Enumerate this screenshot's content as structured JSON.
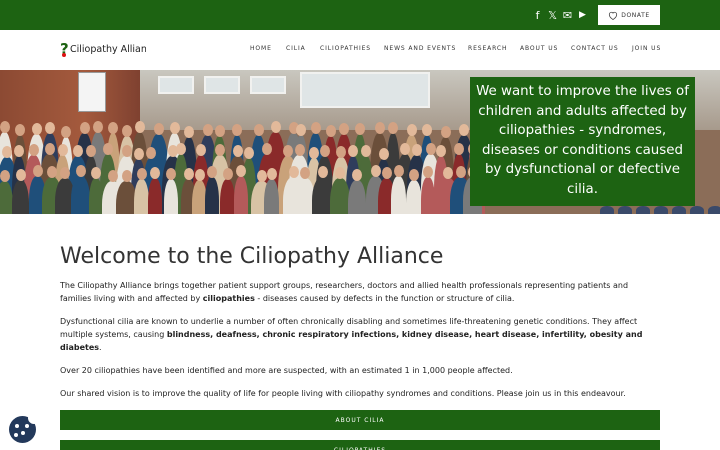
{
  "topbar": {
    "social": [
      {
        "name": "facebook-icon",
        "glyph": "f"
      },
      {
        "name": "x-twitter-icon",
        "glyph": "𝕏"
      },
      {
        "name": "email-icon",
        "glyph": "✉"
      },
      {
        "name": "youtube-icon",
        "glyph": "▶"
      }
    ],
    "donate_label": "DONATE",
    "donate_icon": "heart-icon"
  },
  "brand": {
    "name": "Ciliopathy Alliance",
    "mark": "?"
  },
  "nav": {
    "items": [
      {
        "label": "HOME"
      },
      {
        "label": "CILIA"
      },
      {
        "label": "CILIOPATHIES"
      },
      {
        "label": "NEWS AND EVENTS"
      },
      {
        "label": "RESEARCH"
      },
      {
        "label": "ABOUT US"
      },
      {
        "label": "CONTACT US"
      },
      {
        "label": "JOIN US"
      }
    ]
  },
  "hero": {
    "quote": "We want to improve the lives of children and adults affected by ciliopathies - syndromes, diseases or conditions caused by dysfunctional or defective cilia."
  },
  "main": {
    "title": "Welcome to the Ciliopathy Alliance",
    "p1_a": "The Ciliopathy Alliance brings together patient support groups, researchers, doctors and allied health professionals representing patients and families living with and affected by ",
    "p1_b": "ciliopathies",
    "p1_c": " - diseases caused by defects in the function or structure of cilia.",
    "p2_a": "Dysfunctional cilia are known to underlie a number of often chronically disabling and sometimes life-threatening genetic conditions. They affect multiple systems, causing ",
    "p2_b": "blindness, deafness, chronic respiratory infections, kidney disease, heart disease, infertility, obesity and diabetes",
    "p2_c": ".",
    "p3": "Over 20 ciliopathies have been identified and more are suspected, with an estimated 1 in 1,000 people affected.",
    "p4": "Our shared vision is to improve the quality of life for people living with ciliopathy syndromes and conditions. Please join us in this endeavour.",
    "buttons": [
      {
        "label": "ABOUT CILIA"
      },
      {
        "label": "CILIOPATHIES"
      }
    ]
  },
  "colors": {
    "brand_green": "#1d6312",
    "cookie_blue": "#23395b"
  }
}
